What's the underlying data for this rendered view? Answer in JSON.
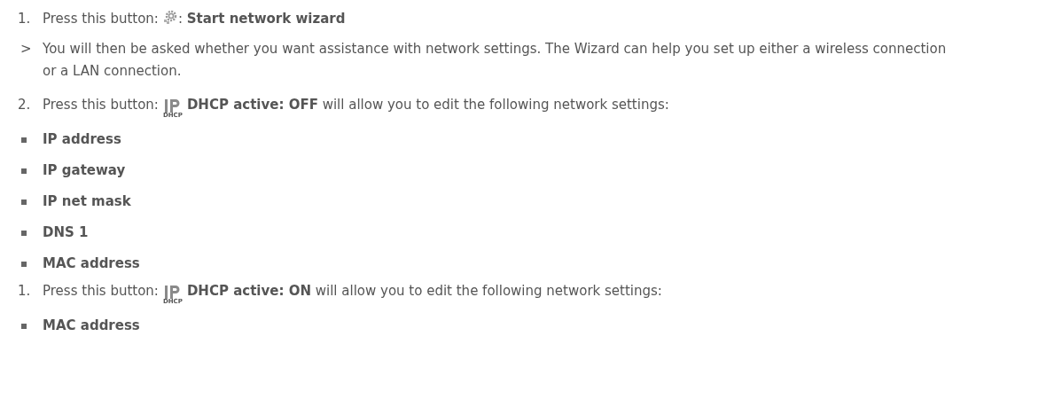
{
  "items": [
    {
      "kind": "numbered",
      "marker": "1.",
      "prefix": "Press this button:",
      "suffix": ": **Start network wizard**"
    },
    {
      "kind": "result",
      "marker": ">",
      "text": "You will then be asked whether you want assistance with network settings. The Wizard can help you set up either a wireless connection or a LAN connection."
    },
    {
      "kind": "numbered",
      "marker": "2.",
      "prefix": "Press this button:",
      "icon_label": "DHCP",
      "suffix": "**DHCP active: OFF** will allow you to edit the following network settings:"
    },
    {
      "kind": "bullet",
      "text": "IP address"
    },
    {
      "kind": "bullet",
      "text": "IP gateway"
    },
    {
      "kind": "bullet",
      "text": "IP net mask"
    },
    {
      "kind": "bullet",
      "text": "DNS 1"
    },
    {
      "kind": "bullet",
      "text": "MAC address"
    },
    {
      "kind": "numbered",
      "marker": "1.",
      "prefix": "Press this button:",
      "icon_label": "DHCP",
      "suffix": "**DHCP active: ON** will allow you to edit the following network settings:"
    },
    {
      "kind": "bullet",
      "text": "MAC address"
    }
  ]
}
